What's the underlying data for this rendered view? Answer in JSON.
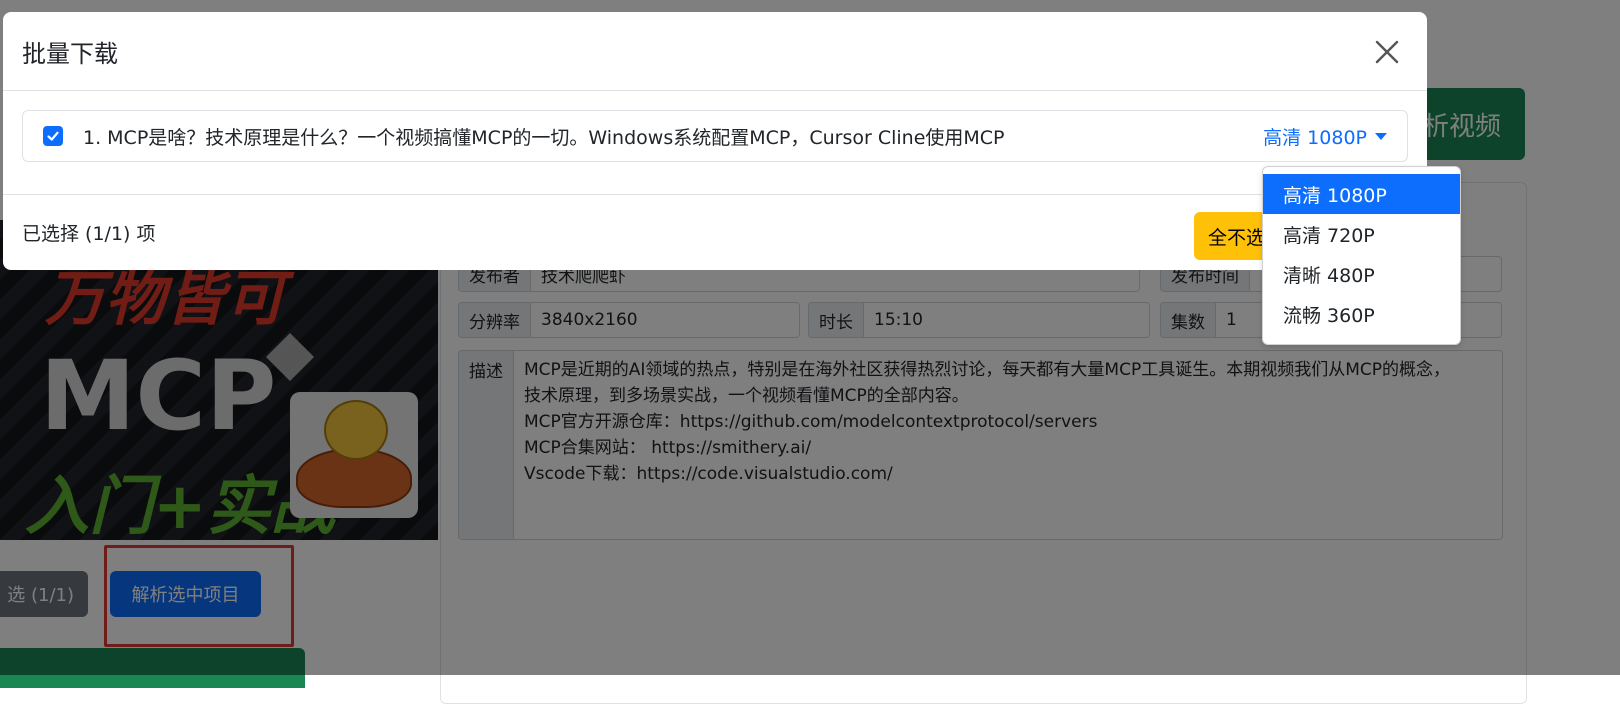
{
  "background": {
    "parse_video_label": "析视频",
    "info": {
      "publisher_label": "发布者",
      "publisher_value": "技术爬爬虾",
      "publish_time_label": "发布时间",
      "resolution_label": "分辨率",
      "resolution_value": "3840x2160",
      "duration_label": "时长",
      "duration_value": "15:10",
      "episodes_label": "集数",
      "episodes_value": "1",
      "description_label": "描述",
      "description_lines": [
        "MCP是近期的AI领域的热点，特别是在海外社区获得热烈讨论，每天都有大量MCP工具诞生。本期视频我们从MCP的概念，",
        "技术原理，到多场景实战，一个视频看懂MCP的全部内容。",
        "MCP官方开源仓库：https://github.com/modelcontextprotocol/servers",
        "MCP合集网站： https://smithery.ai/",
        "Vscode下载：https://code.visualstudio.com/"
      ]
    },
    "thumbnail": {
      "line1": "万物皆可",
      "line2": "MCP",
      "line3": "入门+实战"
    },
    "select_toggle_label": "选 (1/1)",
    "parse_selected_label": "解析选中项目"
  },
  "modal": {
    "title": "批量下载",
    "items": [
      {
        "title": "1. MCP是啥？技术原理是什么？一个视频搞懂MCP的一切。Windows系统配置MCP，Cursor Cline使用MCP",
        "quality": "高清 1080P",
        "checked": true
      }
    ],
    "selected_count_text": "已选择 (1/1) 项",
    "select_none_label": "全不选"
  },
  "dropdown": {
    "options": [
      "高清 1080P",
      "高清 720P",
      "清晰 480P",
      "流畅 360P"
    ],
    "selected": "高清 1080P"
  },
  "colors": {
    "primary": "#0d6efd",
    "success": "#198754",
    "warning": "#ffc107",
    "secondary": "#6c757d",
    "highlight": "#e53935"
  }
}
